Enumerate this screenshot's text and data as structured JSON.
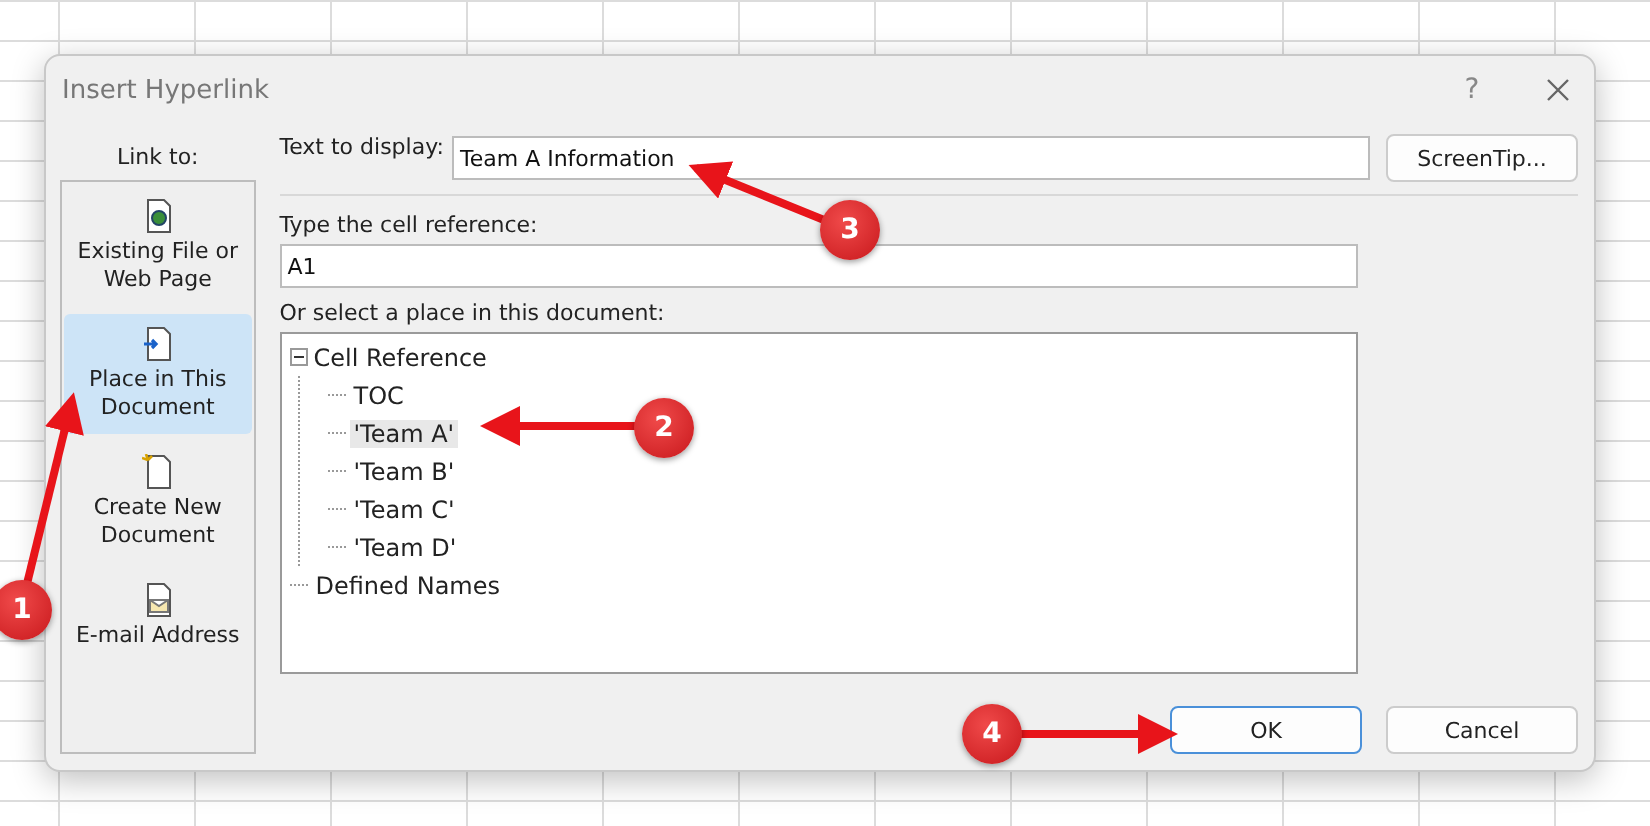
{
  "window": {
    "title": "Insert Hyperlink",
    "help": "?"
  },
  "link_to": {
    "label": "Link to:",
    "items": [
      {
        "label": "Existing File or Web Page",
        "kind": "file",
        "selected": false
      },
      {
        "label": "Place in This Document",
        "kind": "place",
        "selected": true
      },
      {
        "label": "Create New Document",
        "kind": "new",
        "selected": false
      },
      {
        "label": "E-mail Address",
        "kind": "mail",
        "selected": false
      }
    ]
  },
  "text_to_display": {
    "label": "Text to display:",
    "value": "Team A Information"
  },
  "screentip_button": "ScreenTip...",
  "cell_reference": {
    "label": "Type the cell reference:",
    "value": "A1"
  },
  "place_tree": {
    "label": "Or select a place in this document:",
    "items": [
      {
        "label": "Cell Reference",
        "expanded": true,
        "selected": false,
        "children": [
          {
            "label": "TOC",
            "selected": false
          },
          {
            "label": "'Team A'",
            "selected": true
          },
          {
            "label": "'Team B'",
            "selected": false
          },
          {
            "label": "'Team C'",
            "selected": false
          },
          {
            "label": "'Team D'",
            "selected": false
          }
        ]
      },
      {
        "label": "Defined Names",
        "selected": false
      }
    ]
  },
  "buttons": [
    {
      "label": "OK",
      "default": true
    },
    {
      "label": "Cancel",
      "default": false
    }
  ],
  "annotations": [
    {
      "label": "1"
    },
    {
      "label": "2"
    },
    {
      "label": "3"
    },
    {
      "label": "4"
    }
  ]
}
